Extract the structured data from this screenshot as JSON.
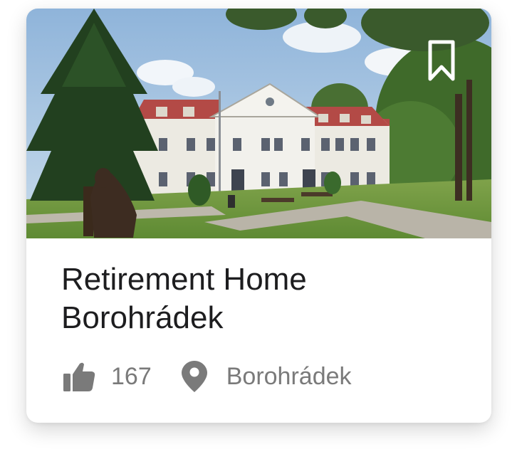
{
  "card": {
    "title": "Retirement Home Borohrádek",
    "likes": "167",
    "location": "Borohrádek"
  },
  "icons": {
    "bookmark": "bookmark-icon",
    "like": "thumbs-up-icon",
    "location": "map-pin-icon"
  },
  "colors": {
    "text_primary": "#1d1d1f",
    "text_secondary": "#7a7a7a",
    "card_background": "#ffffff"
  }
}
